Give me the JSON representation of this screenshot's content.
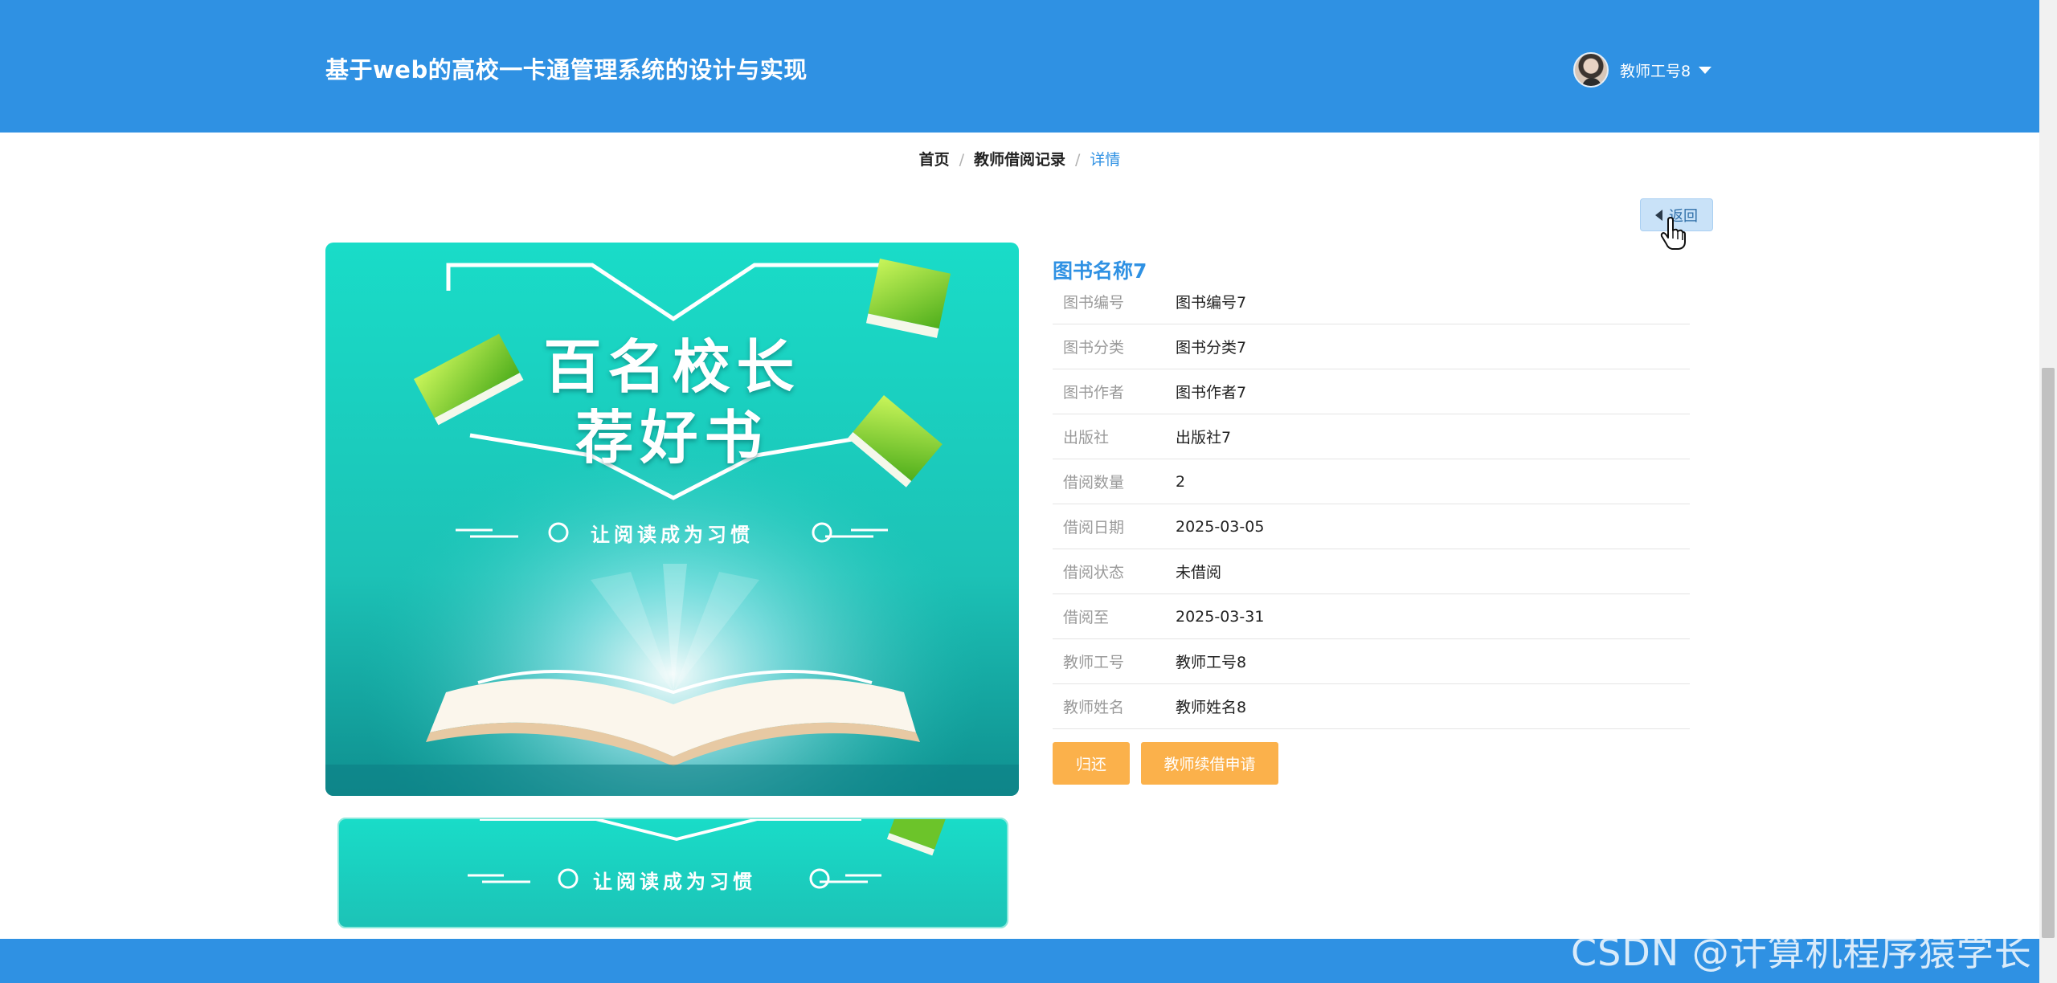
{
  "header": {
    "site_title": "基于web的高校一卡通管理系统的设计与实现",
    "user_name": "教师工号8"
  },
  "breadcrumb": {
    "items": [
      "首页",
      "教师借阅记录"
    ],
    "current": "详情"
  },
  "back_label": "返回",
  "book": {
    "title": "图书名称7",
    "cover_text": {
      "line1": "百名校长",
      "line2": "荐好书",
      "slogan": "让阅读成为习惯"
    },
    "fields": [
      {
        "label": "图书编号",
        "value": "图书编号7"
      },
      {
        "label": "图书分类",
        "value": "图书分类7"
      },
      {
        "label": "图书作者",
        "value": "图书作者7"
      },
      {
        "label": "出版社",
        "value": "出版社7"
      },
      {
        "label": "借阅数量",
        "value": "2"
      },
      {
        "label": "借阅日期",
        "value": "2025-03-05"
      },
      {
        "label": "借阅状态",
        "value": "未借阅"
      },
      {
        "label": "借阅至",
        "value": "2025-03-31"
      },
      {
        "label": "教师工号",
        "value": "教师工号8"
      },
      {
        "label": "教师姓名",
        "value": "教师姓名8"
      }
    ]
  },
  "actions": {
    "return_label": "归还",
    "renew_label": "教师续借申请"
  },
  "watermark": "CSDN @计算机程序猿学长",
  "colors": {
    "primary": "#2f91e3",
    "accent_orange": "#fbb14b",
    "teal": "#1fd6c0"
  }
}
